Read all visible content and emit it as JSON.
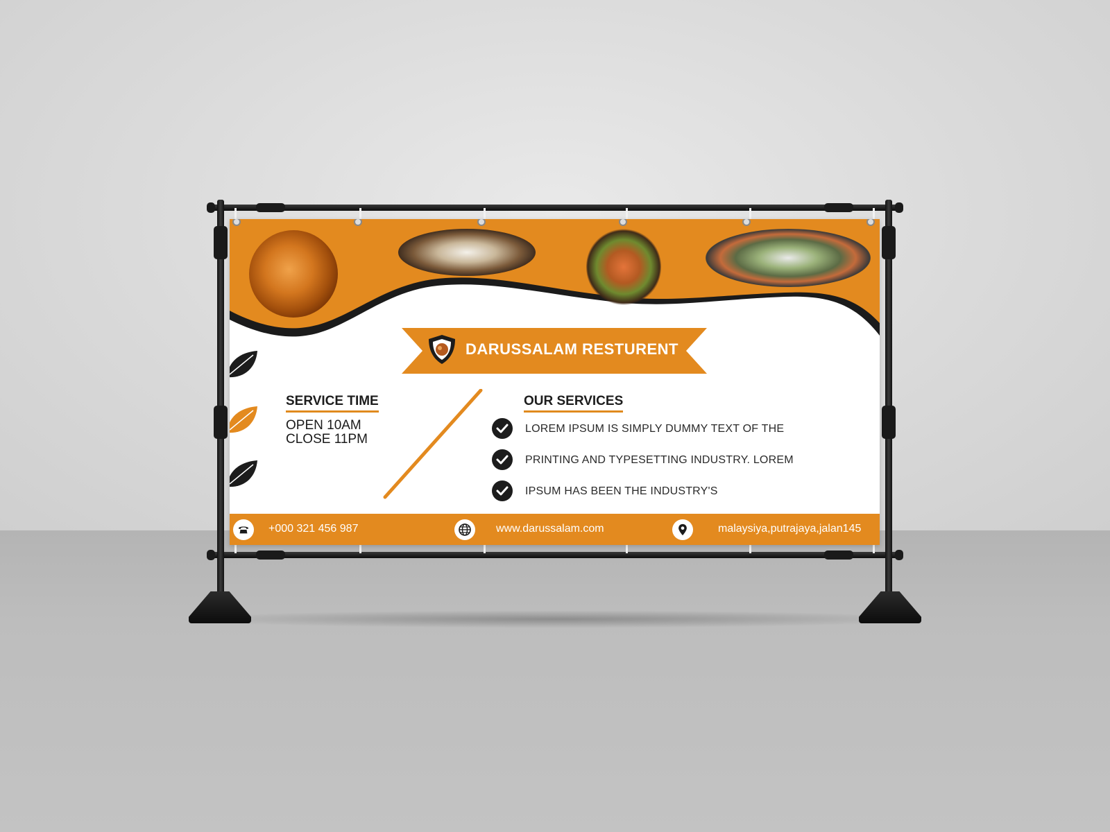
{
  "banner": {
    "title": "DARUSSALAM RESTURENT",
    "service_time": {
      "heading": "SERVICE TIME",
      "open": "OPEN 10AM",
      "close": "CLOSE 11PM"
    },
    "our_services": {
      "heading": "OUR SERVICES",
      "items": [
        "LOREM IPSUM IS SIMPLY DUMMY TEXT OF THE",
        "PRINTING AND TYPESETTING INDUSTRY. LOREM",
        "IPSUM HAS BEEN THE INDUSTRY'S"
      ]
    },
    "footer": {
      "phone": "+000 321 456 987",
      "website": "www.darussalam.com",
      "address": "malaysiya,putrajaya,jalan145"
    },
    "food_images": [
      "fried-chicken",
      "dinner-table-spread",
      "stir-fried-noodles",
      "shared-dishes-table"
    ],
    "icons": [
      "phone-icon",
      "globe-icon",
      "location-pin-icon",
      "check-icon",
      "shield-logo-icon",
      "leaf-icon"
    ]
  },
  "colors": {
    "accent_orange": "#e38a1f",
    "dark": "#1c1c1c",
    "white": "#ffffff",
    "wall": "#dedede",
    "floor": "#bdbdbd"
  }
}
